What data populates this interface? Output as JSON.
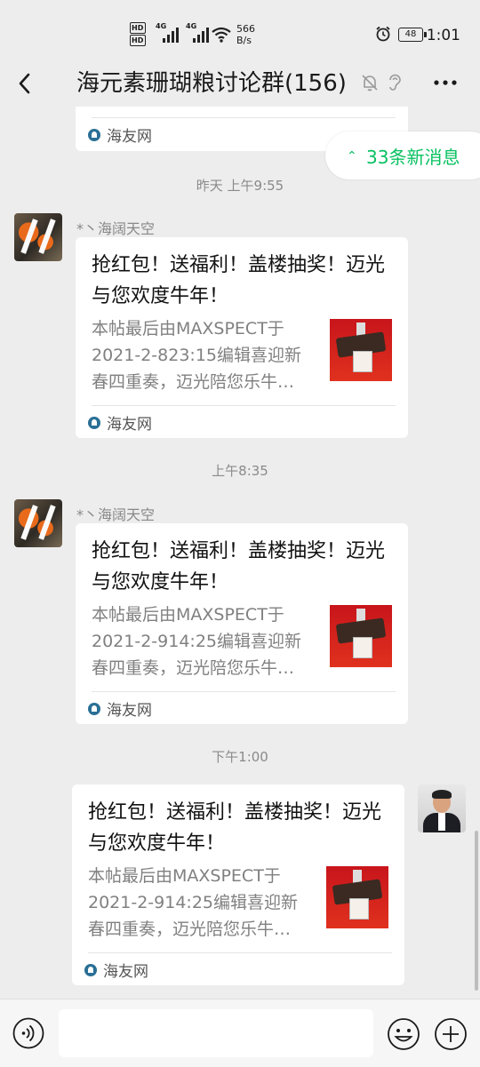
{
  "status": {
    "network_speed_value": "566",
    "network_speed_unit": "B/s",
    "battery": "48",
    "time": "1:01",
    "hd1": "HD",
    "hd2": "HD",
    "net1": "4G",
    "net2": "4G"
  },
  "header": {
    "title": "海元素珊瑚粮讨论群(156)"
  },
  "new_messages": {
    "label": "33条新消息"
  },
  "top_card": {
    "source": "海友网"
  },
  "messages": [
    {
      "time": "昨天 上午9:55",
      "sender": "*丶海阔天空",
      "title": "抢红包！送福利！盖楼抽奖！迈光与您欢度牛年！",
      "desc": "本帖最后由MAXSPECT于2021-2-823:15编辑喜迎新春四重奏，迈光陪您乐牛…",
      "source": "海友网"
    },
    {
      "time": "上午8:35",
      "sender": "*丶海阔天空",
      "title": "抢红包！送福利！盖楼抽奖！迈光与您欢度牛年！",
      "desc": "本帖最后由MAXSPECT于2021-2-914:25编辑喜迎新春四重奏，迈光陪您乐牛…",
      "source": "海友网"
    },
    {
      "time": "下午1:00",
      "sender": "",
      "title": "抢红包！送福利！盖楼抽奖！迈光与您欢度牛年！",
      "desc": "本帖最后由MAXSPECT于2021-2-914:25编辑喜迎新春四重奏，迈光陪您乐牛…",
      "source": "海友网"
    }
  ],
  "colors": {
    "background": "#ededed",
    "accent": "#07c160",
    "card": "#ffffff"
  }
}
